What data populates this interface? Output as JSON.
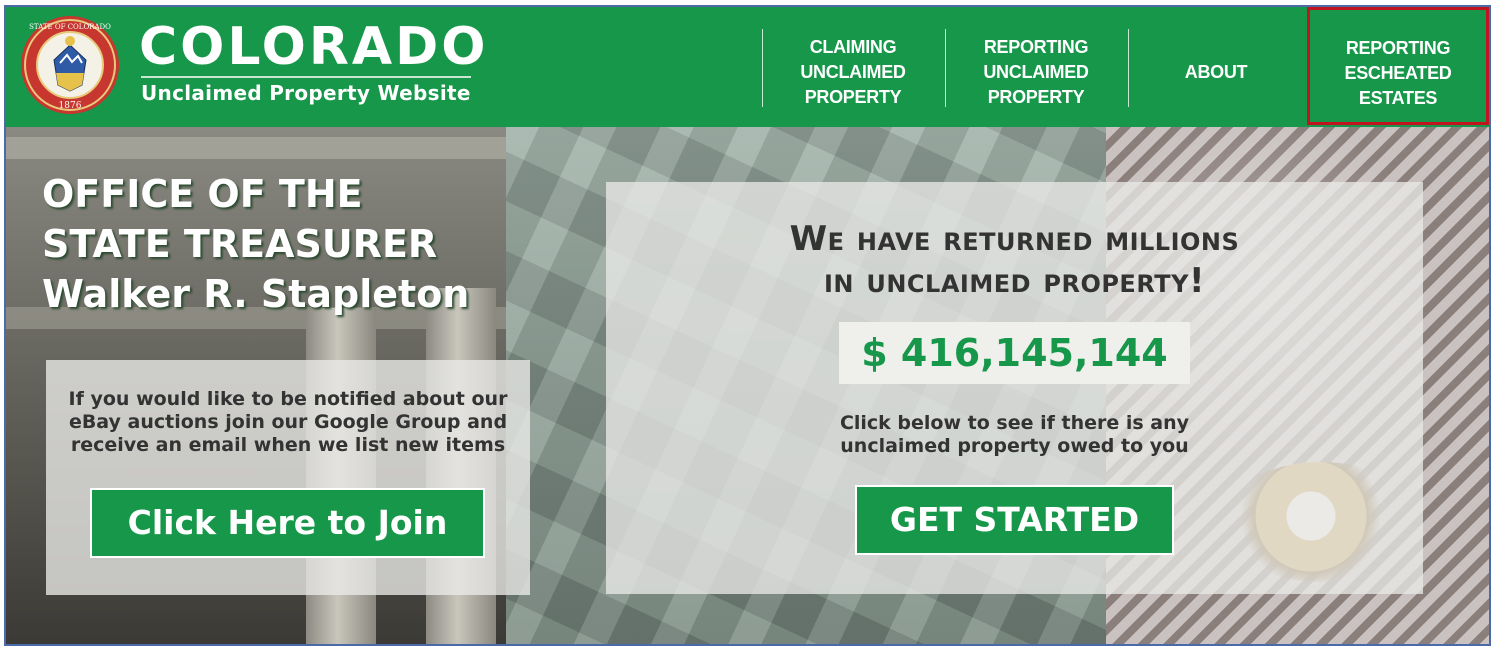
{
  "header": {
    "brand_title": "COLORADO",
    "brand_subtitle": "Unclaimed Property Website",
    "seal": {
      "top_text": "STATE OF COLORADO",
      "year": "1876"
    },
    "nav": [
      {
        "line1": "CLAIMING",
        "line2": "UNCLAIMED",
        "line3": "PROPERTY"
      },
      {
        "line1": "REPORTING",
        "line2": "UNCLAIMED",
        "line3": "PROPERTY"
      },
      {
        "line1": "ABOUT"
      },
      {
        "line1": "REPORTING",
        "line2": "ESCHEATED",
        "line3": "ESTATES"
      }
    ]
  },
  "hero": {
    "office_line1": "OFFICE OF THE",
    "office_line2": "STATE TREASURER",
    "office_line3": "Walker R. Stapleton",
    "left_panel": {
      "line1": "If you would like to be notified about our",
      "line2": "eBay auctions join our Google Group and",
      "line3": "receive an email when we list new items",
      "button_label": "Click Here to Join"
    },
    "right_panel": {
      "headline_line1": "We have returned millions",
      "headline_line2": "in unclaimed property!",
      "amount": "$ 416,145,144",
      "sub_line1": "Click below to see if there is any",
      "sub_line2": "unclaimed property owed to you",
      "button_label": "GET STARTED"
    }
  },
  "colors": {
    "brand_green": "#17974a",
    "highlight_red": "#c0141e",
    "panel_text": "#333333"
  }
}
